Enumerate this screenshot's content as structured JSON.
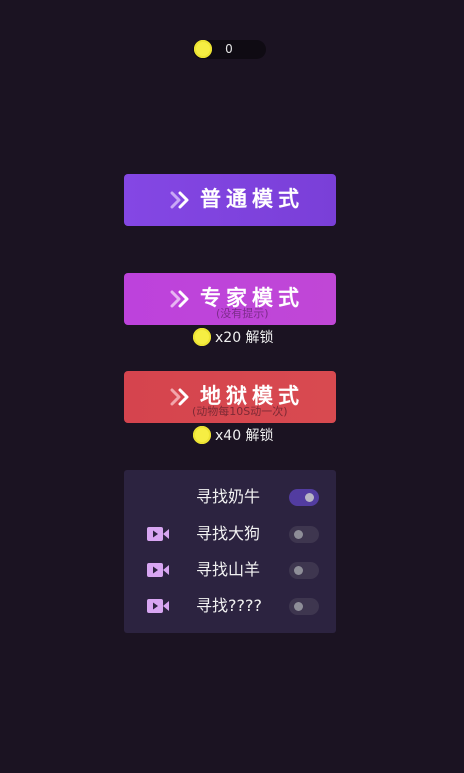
{
  "coins": {
    "icon": "coin-icon",
    "count": "0",
    "color": "#f6ee43"
  },
  "modes": [
    {
      "label": "普通模式",
      "subtitle": "",
      "color": "#8447e4"
    },
    {
      "label": "专家模式",
      "subtitle": "(没有提示)",
      "unlock": "x20 解锁",
      "color": "#bd42dc"
    },
    {
      "label": "地狱模式",
      "subtitle": "(动物每10S动一次)",
      "unlock": "x40 解锁",
      "color": "#d5444e"
    }
  ],
  "targets": [
    {
      "label": "寻找奶牛",
      "icon": "",
      "enabled": true
    },
    {
      "label": "寻找大狗",
      "icon": "video-camera-icon",
      "enabled": false
    },
    {
      "label": "寻找山羊",
      "icon": "video-camera-icon",
      "enabled": false
    },
    {
      "label": "寻找????",
      "icon": "video-camera-icon",
      "enabled": false
    }
  ]
}
